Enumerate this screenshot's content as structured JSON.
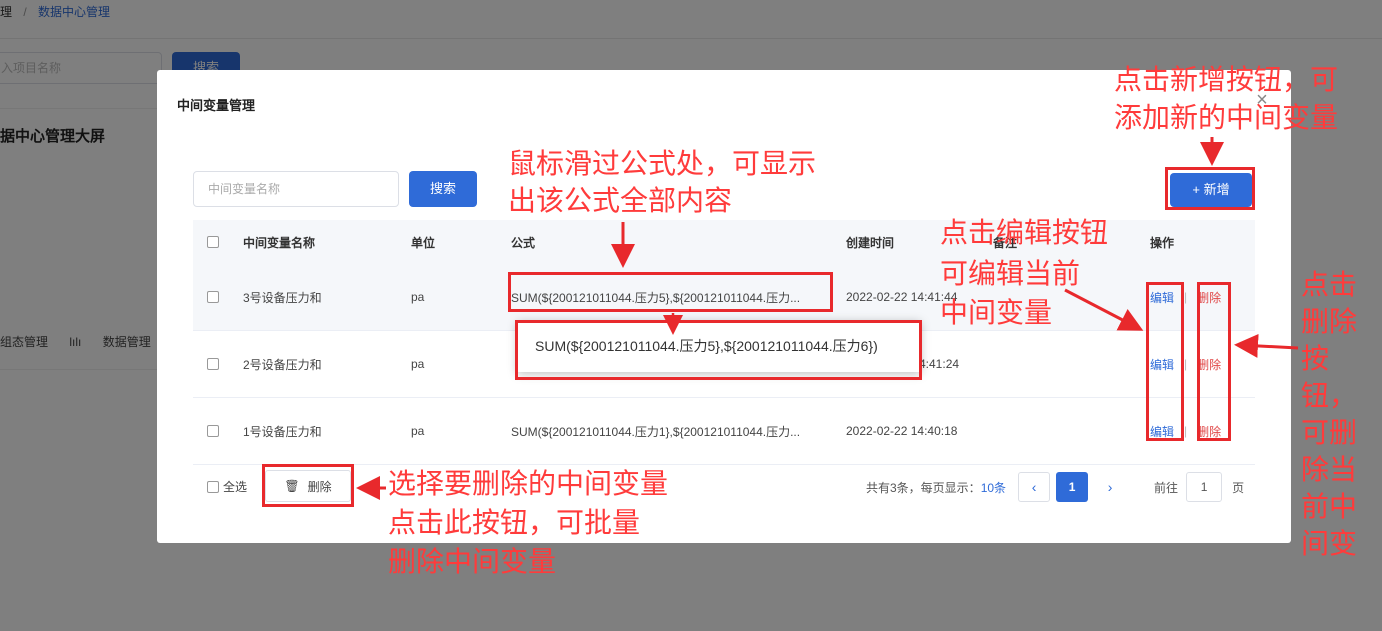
{
  "breadcrumb": {
    "prefix": "理",
    "sep": "/",
    "current": "数据中心管理"
  },
  "bg": {
    "search_placeholder": "入项目名称",
    "search_button": "搜索",
    "card_title": "据中心管理大屏",
    "link1": "组态管理",
    "link2": "数据管理"
  },
  "dialog": {
    "title": "中间变量管理",
    "search_placeholder": "中间变量名称",
    "search_button": "搜索",
    "add_button": "+ 新增",
    "columns": {
      "name": "中间变量名称",
      "unit": "单位",
      "formula": "公式",
      "time": "创建时间",
      "note": "备注",
      "op": "操作"
    },
    "rows": [
      {
        "name": "3号设备压力和",
        "unit": "pa",
        "formula": "SUM(${200121011044.压力5},${200121011044.压力...",
        "time": "2022-02-22 14:41:44",
        "edit": "编辑",
        "delete": "删除"
      },
      {
        "name": "2号设备压力和",
        "unit": "pa",
        "formula": "",
        "time": "4:41:24",
        "edit": "编辑",
        "delete": "删除"
      },
      {
        "name": "1号设备压力和",
        "unit": "pa",
        "formula": "SUM(${200121011044.压力1},${200121011044.压力...",
        "time": "2022-02-22 14:40:18",
        "edit": "编辑",
        "delete": "删除"
      }
    ],
    "tooltip": "SUM(${200121011044.压力5},${200121011044.压力6})",
    "select_all": "全选",
    "batch_delete": "删除",
    "total_text": "共有3条，每页显示：",
    "page_size": "10条",
    "current_page": "1",
    "goto_label": "前往",
    "goto_value": "1",
    "page_label": "页"
  },
  "annotations": {
    "add_line1": "点击新增按钮，可",
    "add_line2": "添加新的中间变量",
    "formula_line1": "鼠标滑过公式处，可显示",
    "formula_line2": "出该公式全部内容",
    "edit_line1": "点击编辑按钮",
    "edit_line2": "可编辑当前",
    "edit_line3": "中间变量",
    "del_col": [
      "点击",
      "删除",
      "按",
      "钮，",
      "可删",
      "除当",
      "前中",
      "间变"
    ],
    "batch_line1": "选择要删除的中间变量",
    "batch_line2": "点击此按钮，可批量",
    "batch_line3": "删除中间变量"
  },
  "colors": {
    "primary": "#2f6bd8",
    "annotation": "#ff3b3b",
    "delete": "#e04848"
  }
}
